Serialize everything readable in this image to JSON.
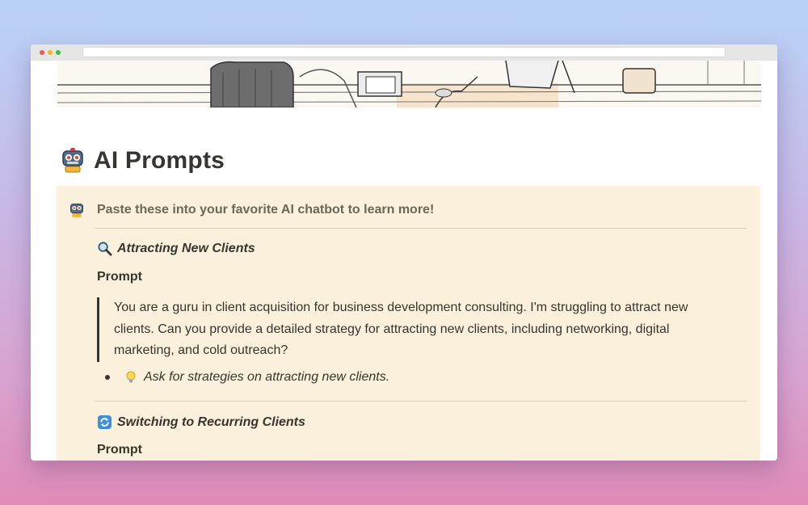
{
  "browser": {
    "window_buttons": [
      "close",
      "minimize",
      "maximize"
    ],
    "url": ""
  },
  "page": {
    "icon": "robot-icon",
    "title": "AI Prompts"
  },
  "callout": {
    "icon": "robot-icon",
    "text": "Paste these into your favorite AI chatbot to learn more!",
    "background_color": "#fbf0db"
  },
  "sections": [
    {
      "icon": "magnifier-icon",
      "title": "Attracting New Clients",
      "prompt_label": "Prompt",
      "quote": "You are a guru in client acquisition for business development consulting. I'm struggling to attract new clients. Can you provide a detailed strategy for attracting new clients, including networking, digital marketing, and cold outreach?",
      "bullet_icon": "lightbulb-icon",
      "bullet_text": "Ask for strategies on attracting new clients."
    },
    {
      "icon": "repeat-icon",
      "title": "Switching to Recurring Clients",
      "prompt_label": "Prompt"
    }
  ]
}
